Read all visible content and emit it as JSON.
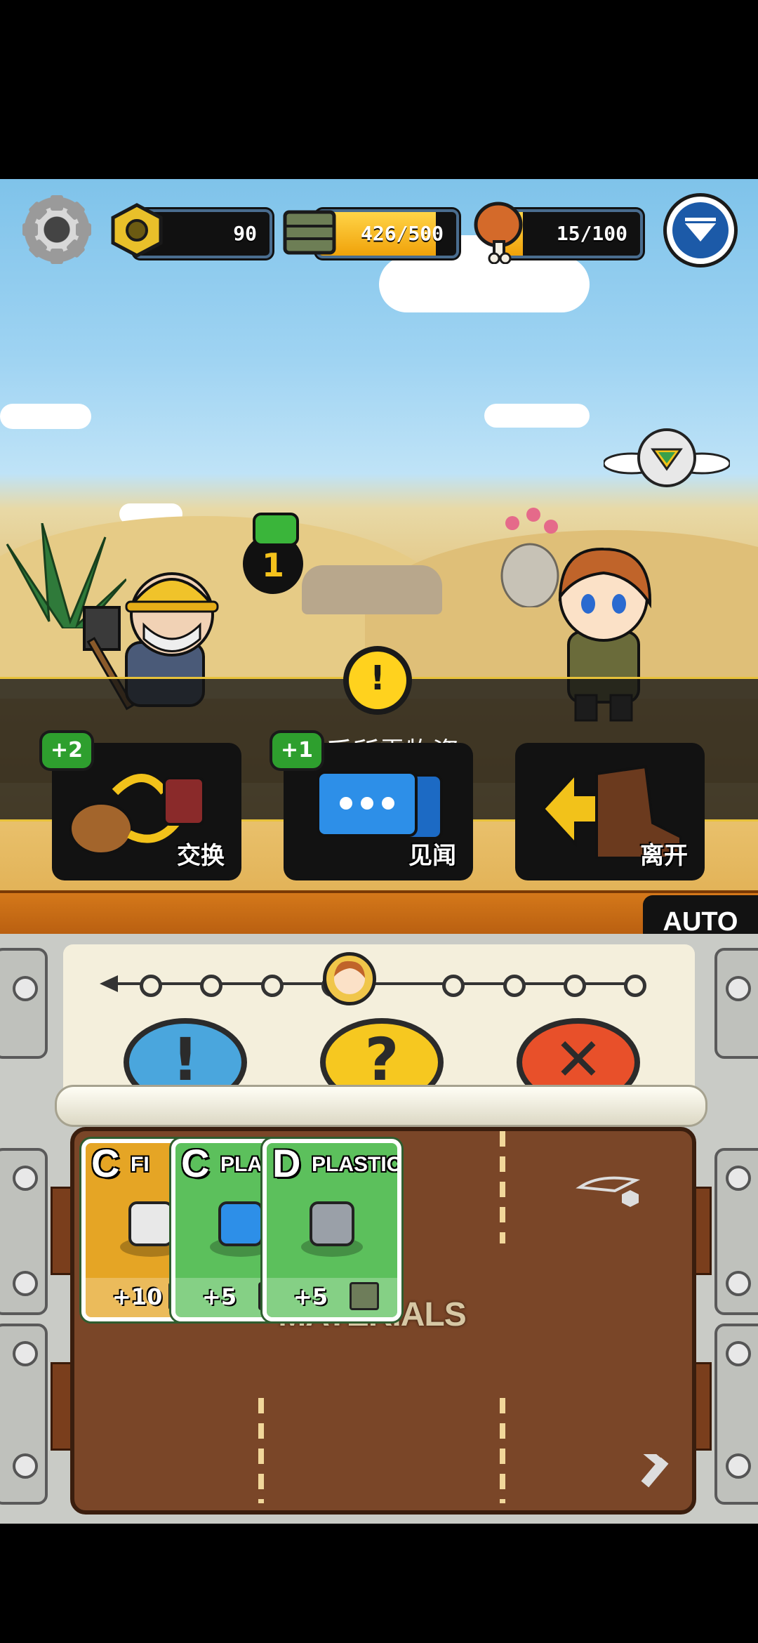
{
  "hud": {
    "nuts": "90",
    "storage": "426/500",
    "storage_fill": 0.85,
    "food": "15/100",
    "food_fill": 0.15
  },
  "encounter": {
    "counter": "1",
    "message": "缺乏所需物资"
  },
  "actions": [
    {
      "label": "交换",
      "badge": "+2"
    },
    {
      "label": "见闻",
      "badge": "+1"
    },
    {
      "label": "离开"
    }
  ],
  "auto_label": "AUTO",
  "progress": {
    "nodes": 9,
    "current": 4
  },
  "choices": [
    "!",
    "?",
    "✕"
  ],
  "board": {
    "label": "MATERIALS"
  },
  "cards": [
    {
      "grade": "C",
      "name": "FI",
      "amount": "+10",
      "color": "#e5a525"
    },
    {
      "grade": "C",
      "name": "PLAS",
      "amount": "+5",
      "color": "#5cc05c"
    },
    {
      "grade": "D",
      "name": "PLASTIC",
      "amount": "+5",
      "color": "#5cc05c"
    }
  ]
}
